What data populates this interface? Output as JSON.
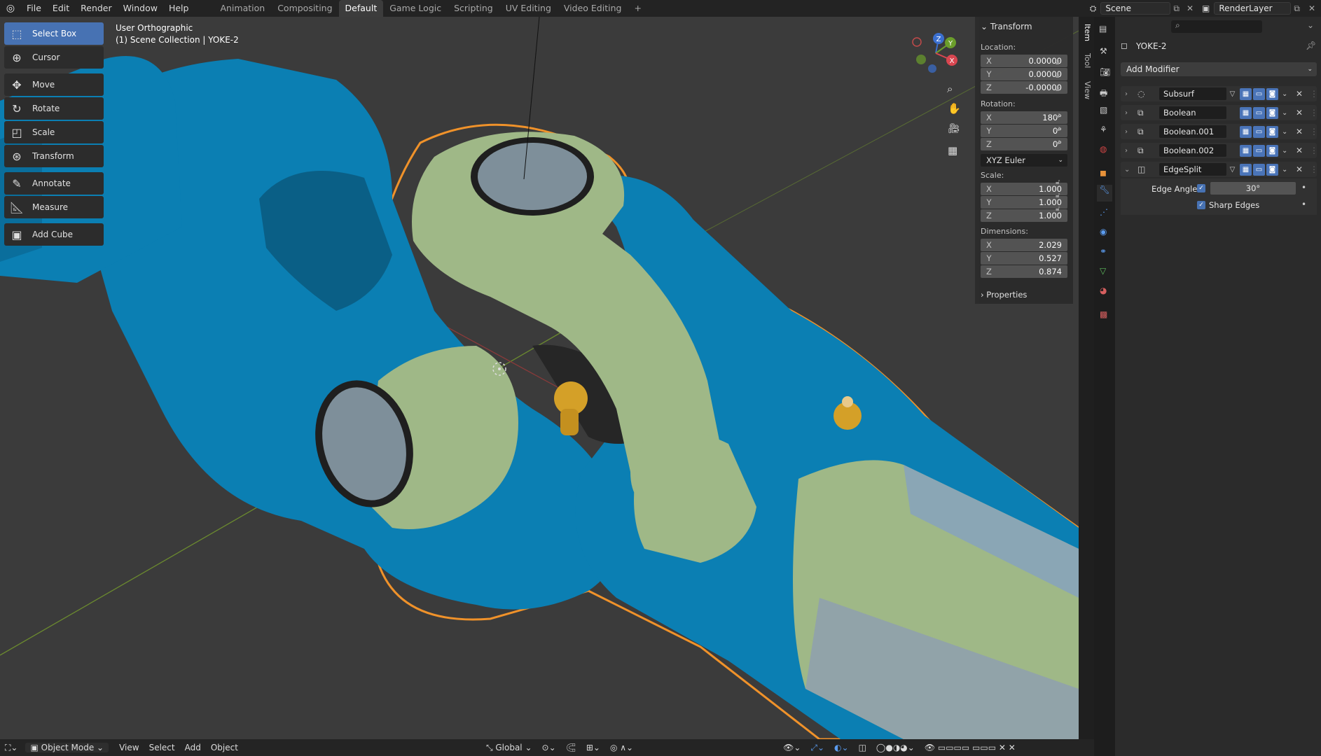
{
  "topbar": {
    "menus": [
      "File",
      "Edit",
      "Render",
      "Window",
      "Help"
    ],
    "workspaces": [
      "Animation",
      "Compositing",
      "Default",
      "Game Logic",
      "Scripting",
      "UV Editing",
      "Video Editing"
    ],
    "active_workspace": "Default",
    "add_tab": "+",
    "scene": "Scene",
    "render_layer": "RenderLayer"
  },
  "viewport": {
    "view_name": "User Orthographic",
    "collection": "(1) Scene Collection | YOKE-2",
    "gizmo_axes": [
      "Z",
      "Y",
      "X"
    ]
  },
  "toolbar": {
    "items": [
      "Select Box",
      "Cursor",
      "Move",
      "Rotate",
      "Scale",
      "Transform",
      "Annotate",
      "Measure",
      "Add Cube"
    ]
  },
  "npanel": {
    "title": "Transform",
    "location_label": "Location:",
    "location": [
      [
        "X",
        "0.00000"
      ],
      [
        "Y",
        "0.00000"
      ],
      [
        "Z",
        "-0.00000"
      ]
    ],
    "rotation_label": "Rotation:",
    "rotation": [
      [
        "X",
        "180°"
      ],
      [
        "Y",
        "0°"
      ],
      [
        "Z",
        "0°"
      ]
    ],
    "rotation_mode": "XYZ Euler",
    "scale_label": "Scale:",
    "scale": [
      [
        "X",
        "1.000"
      ],
      [
        "Y",
        "1.000"
      ],
      [
        "Z",
        "1.000"
      ]
    ],
    "dimensions_label": "Dimensions:",
    "dimensions": [
      [
        "X",
        "2.029"
      ],
      [
        "Y",
        "0.527"
      ],
      [
        "Z",
        "0.874"
      ]
    ],
    "properties": "Properties",
    "tabs": [
      "Item",
      "Tool",
      "View"
    ]
  },
  "properties": {
    "object_name": "YOKE-2",
    "add_modifier": "Add Modifier",
    "modifiers": [
      "Subsurf",
      "Boolean",
      "Boolean.001",
      "Boolean.002",
      "EdgeSplit"
    ],
    "edge_angle_label": "Edge Angle",
    "edge_angle_value": "30°",
    "sharp_edges_label": "Sharp Edges"
  },
  "bottombar": {
    "mode": "Object Mode",
    "menus": [
      "View",
      "Select",
      "Add",
      "Object"
    ],
    "orientation": "Global"
  },
  "colors": {
    "accent": "#4772b3",
    "yoke_blue": "#0b7fb3",
    "yoke_green": "#9fb887",
    "selection_orange": "#f0922a",
    "fitting_gold": "#d4a028"
  }
}
